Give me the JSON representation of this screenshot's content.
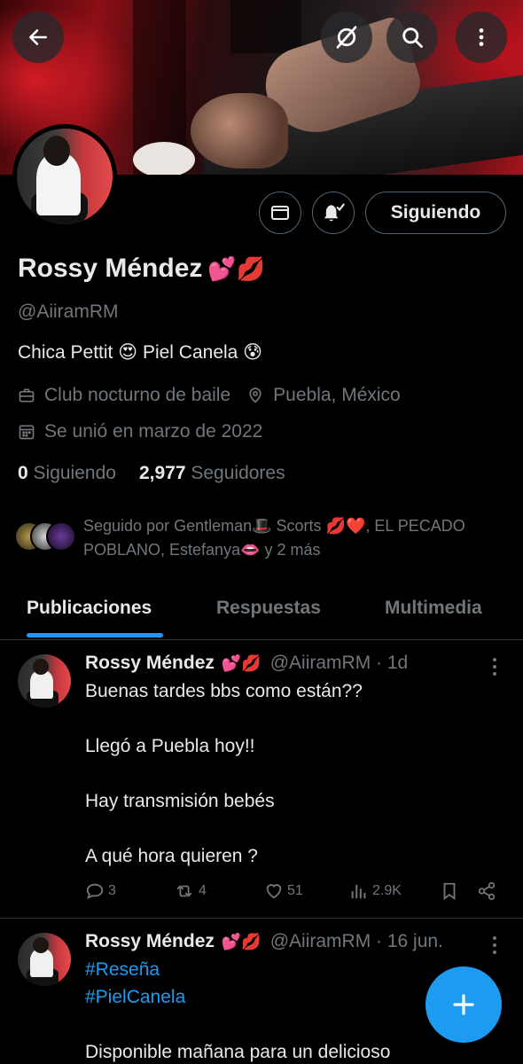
{
  "colors": {
    "accent": "#1d9bf0",
    "muted": "#71767b",
    "text": "#e7e9ea",
    "border": "#2f3336"
  },
  "top_bar": {
    "back_icon": "arrow-left-icon",
    "hide_icon": "eye-off-icon",
    "search_icon": "search-icon",
    "more_icon": "more-vertical-icon"
  },
  "profile": {
    "name": "Rossy Méndez",
    "name_emoji": "💕💋",
    "handle": "@AiiramRM",
    "bio": "Chica Pettit 😍  Piel Canela 😰",
    "category": "Club nocturno de baile",
    "location": "Puebla, México",
    "joined": "Se unió en marzo de 2022",
    "following_count": "0",
    "following_label": "Siguiendo",
    "followers_count": "2,977",
    "followers_label": "Seguidores",
    "follow_button": "Siguiendo",
    "followed_by": "Seguido por Gentleman🎩 Scorts 💋❤️, EL PECADO POBLANO, Estefanya👄 y 2 más"
  },
  "tabs": [
    {
      "label": "Publicaciones",
      "active": true
    },
    {
      "label": "Respuestas",
      "active": false
    },
    {
      "label": "Multimedia",
      "active": false
    }
  ],
  "posts": [
    {
      "name": "Rossy Méndez",
      "name_emoji": "💕💋",
      "handle_time": "@AiiramRM · 1d",
      "lines": [
        "Buenas tardes bbs como están??",
        "",
        "Llegó a Puebla hoy!!",
        "",
        "Hay transmisión bebés",
        "",
        "A qué hora quieren ?"
      ],
      "replies": "3",
      "reposts": "4",
      "likes": "51",
      "views": "2.9K"
    },
    {
      "name": "Rossy Méndez",
      "name_emoji": "💕💋",
      "handle_time": "@AiiramRM · 16 jun.",
      "lines": [
        "#Reseña",
        "#PielCanela",
        "",
        "Disponible mañana para un delicioso"
      ]
    }
  ]
}
